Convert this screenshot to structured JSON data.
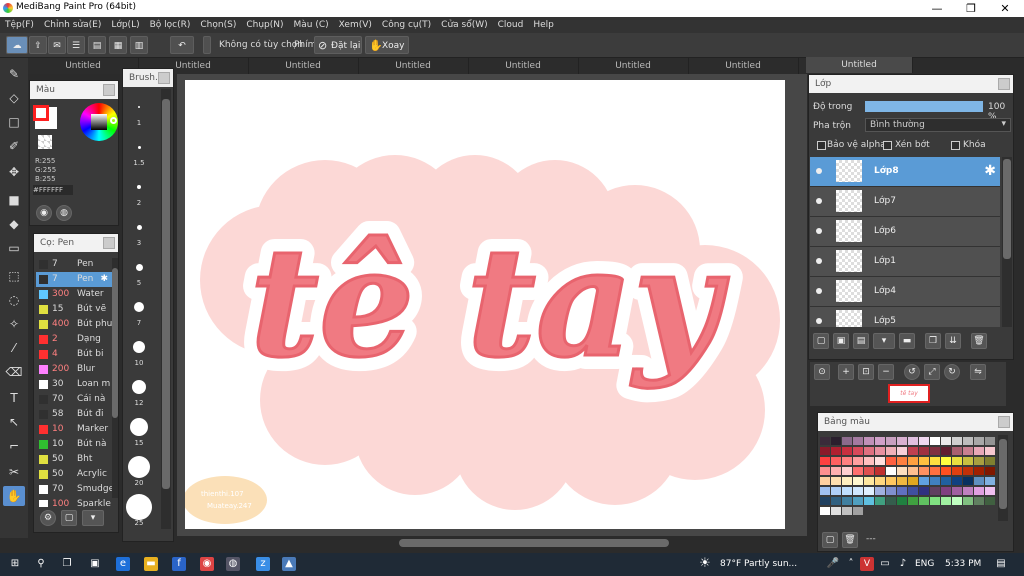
{
  "window": {
    "title": "MediBang Paint Pro (64bit)",
    "minimize": "—",
    "restore": "❐",
    "close": "✕"
  },
  "menu": [
    "Tệp(F)",
    "Chỉnh sửa(E)",
    "Lớp(L)",
    "Bộ lọc(R)",
    "Chọn(S)",
    "Chụp(N)",
    "Màu (C)",
    "Xem(V)",
    "Công cụ(T)",
    "Cửa sổ(W)",
    "Cloud",
    "Help"
  ],
  "toolbar": {
    "no_options": "Không có tùy chọn",
    "key_label": "Phím",
    "reset": "Đặt lại",
    "rotate": "Xoay"
  },
  "tabs": [
    "Untitled",
    "Untitled",
    "Untitled",
    "Untitled",
    "Untitled",
    "Untitled",
    "Untitled",
    "Untitled"
  ],
  "color_panel": {
    "title": "Màu",
    "r": "R:255",
    "g": "G:255",
    "b": "B:255",
    "hex": "#FFFFFF",
    "primary": "#ff2020",
    "secondary": "#ffffff"
  },
  "brush_size_panel": {
    "title": "Brush...",
    "sizes": [
      "1",
      "1.5",
      "2",
      "3",
      "5",
      "7",
      "10",
      "12",
      "15",
      "20",
      "25"
    ]
  },
  "brush_panel": {
    "title": "Cọ: Pen",
    "items": [
      {
        "size": "7",
        "name": "Pen",
        "color": "#303030"
      },
      {
        "size": "7",
        "name": "Pen",
        "color": "#303030",
        "selected": true
      },
      {
        "size": "300",
        "name": "Water",
        "color": "#60c8ff"
      },
      {
        "size": "15",
        "name": "Bút vẽ",
        "color": "#e0e040"
      },
      {
        "size": "400",
        "name": "Bút phun",
        "color": "#e0e040"
      },
      {
        "size": "2",
        "name": "Dạng",
        "color": "#ff3030"
      },
      {
        "size": "4",
        "name": "Bút bi",
        "color": "#ff3030"
      },
      {
        "size": "200",
        "name": "Blur",
        "color": "#ff80ff"
      },
      {
        "size": "30",
        "name": "Loan m",
        "color": "#ffffff"
      },
      {
        "size": "70",
        "name": "Cái nà",
        "color": "#303030"
      },
      {
        "size": "58",
        "name": "Bút đi",
        "color": "#303030"
      },
      {
        "size": "10",
        "name": "Marker",
        "color": "#ff3030"
      },
      {
        "size": "10",
        "name": "Bút nà",
        "color": "#30c030"
      },
      {
        "size": "50",
        "name": "Bht",
        "color": "#e0e040"
      },
      {
        "size": "50",
        "name": "Acrylic",
        "color": "#e0e040"
      },
      {
        "size": "70",
        "name": "Smudge",
        "color": "#ffffff"
      },
      {
        "size": "100",
        "name": "Sparkle",
        "color": "#ffffff"
      }
    ]
  },
  "canvas": {
    "text": "tê tay",
    "watermark_line1": "thienthi.107",
    "watermark_line2": "Muateay.247"
  },
  "layer_panel": {
    "title": "Lớp",
    "opacity_label": "Độ trong",
    "opacity_value": "100 %",
    "opacity_fraction": 1.0,
    "blend_label": "Pha trộn",
    "blend_value": "Bình thường",
    "protect_alpha": "Bảo vệ alpha",
    "clipping": "Xén bớt",
    "lock": "Khóa",
    "layers": [
      "Lớp8",
      "Lớp7",
      "Lớp6",
      "Lớp1",
      "Lớp4",
      "Lớp5"
    ],
    "selected": "Lớp8",
    "navigator_text": "tê tay"
  },
  "palette_panel": {
    "title": "Bảng màu",
    "footer": "---",
    "rows": [
      [
        "#3a2b3a",
        "#2a1f2d",
        "#8c6a8c",
        "#a47aa0",
        "#c090b8",
        "#d0a0c8",
        "#c8a0c0",
        "#d8b0d0",
        "#e0c0e0",
        "#f0d8f0",
        "#ffffff",
        "#eaeaea",
        "#d0d0d0",
        "#bdbdbd",
        "#a8a8a8",
        "#949494"
      ],
      [
        "#8a1a2a",
        "#b02030",
        "#c83040",
        "#d84a5a",
        "#e07080",
        "#e890a0",
        "#f0b0b8",
        "#f8d0d8",
        "#c04050",
        "#a03040",
        "#803040",
        "#602030",
        "#a86070",
        "#c88090",
        "#e8a8b8",
        "#f8c8d0"
      ],
      [
        "#ff4040",
        "#ff6060",
        "#ff8080",
        "#ffa0a0",
        "#ffc0c0",
        "#ffe0e0",
        "#ff6040",
        "#ff8040",
        "#ffa040",
        "#ffc040",
        "#ffe040",
        "#ffff40",
        "#e8e040",
        "#c8c040",
        "#a8a040",
        "#808030"
      ],
      [
        "#ff9090",
        "#ffb0b0",
        "#ffd0d0",
        "#ff7070",
        "#e05050",
        "#c03030",
        "#ffffff",
        "#ffe0c0",
        "#ffc090",
        "#ff9060",
        "#ff7040",
        "#ff5020",
        "#e04010",
        "#c03008",
        "#a02000",
        "#801800"
      ],
      [
        "#ffd0a0",
        "#ffe0b0",
        "#fff0c0",
        "#fff8d0",
        "#ffe8a0",
        "#ffd880",
        "#ffc860",
        "#f0b840",
        "#e0a820",
        "#60a0e0",
        "#4080c0",
        "#2060a0",
        "#104080",
        "#083060",
        "#6090c0",
        "#80b0e0"
      ],
      [
        "#a0c0f0",
        "#b0d0f8",
        "#c0e0ff",
        "#d0e8ff",
        "#e0f0ff",
        "#a0b0e0",
        "#8090d0",
        "#6070c0",
        "#4050a0",
        "#303080",
        "#604060",
        "#804080",
        "#a060a0",
        "#c080c0",
        "#e0a0e0",
        "#f0c0f0"
      ],
      [
        "#204060",
        "#306080",
        "#4080a0",
        "#50a0c0",
        "#60c0e0",
        "#40a080",
        "#30806080",
        "#208040",
        "#40a040",
        "#60c060",
        "#80e080",
        "#a0f0a0",
        "#c0ffc0",
        "#80c080",
        "#608060",
        "#406040"
      ],
      [
        "#ffffff",
        "#e0e0e0",
        "#c0c0c0",
        "#a0a0a0"
      ]
    ]
  },
  "taskbar": {
    "weather": "87°F  Partly sun...",
    "lang": "ENG",
    "time": "5:33 PM"
  }
}
